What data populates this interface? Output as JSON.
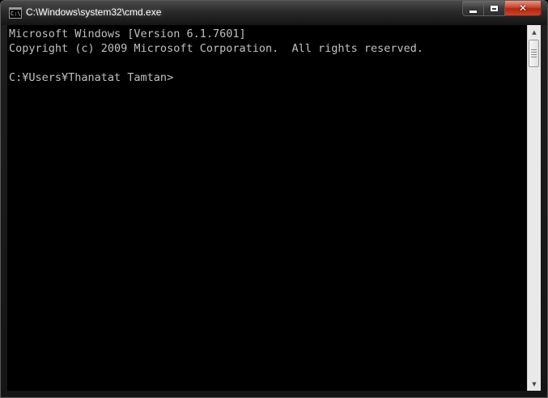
{
  "window": {
    "title": "C:\\Windows\\system32\\cmd.exe",
    "icon_text": "C:\\",
    "controls": {
      "minimize_glyph": "minimize-icon",
      "maximize_glyph": "maximize-icon",
      "close_glyph": "✕"
    }
  },
  "console": {
    "lines": [
      "Microsoft Windows [Version 6.1.7601]",
      "Copyright (c) 2009 Microsoft Corporation.  All rights reserved.",
      "",
      "C:¥Users¥Thanatat Tamtan>"
    ],
    "text_color": "#c0c0c0",
    "background_color": "#000000"
  },
  "scrollbar": {
    "up_arrow": "▲",
    "down_arrow": "▼"
  },
  "colors": {
    "close_button": "#c8452c",
    "titlebar": "#2a2a2a"
  }
}
